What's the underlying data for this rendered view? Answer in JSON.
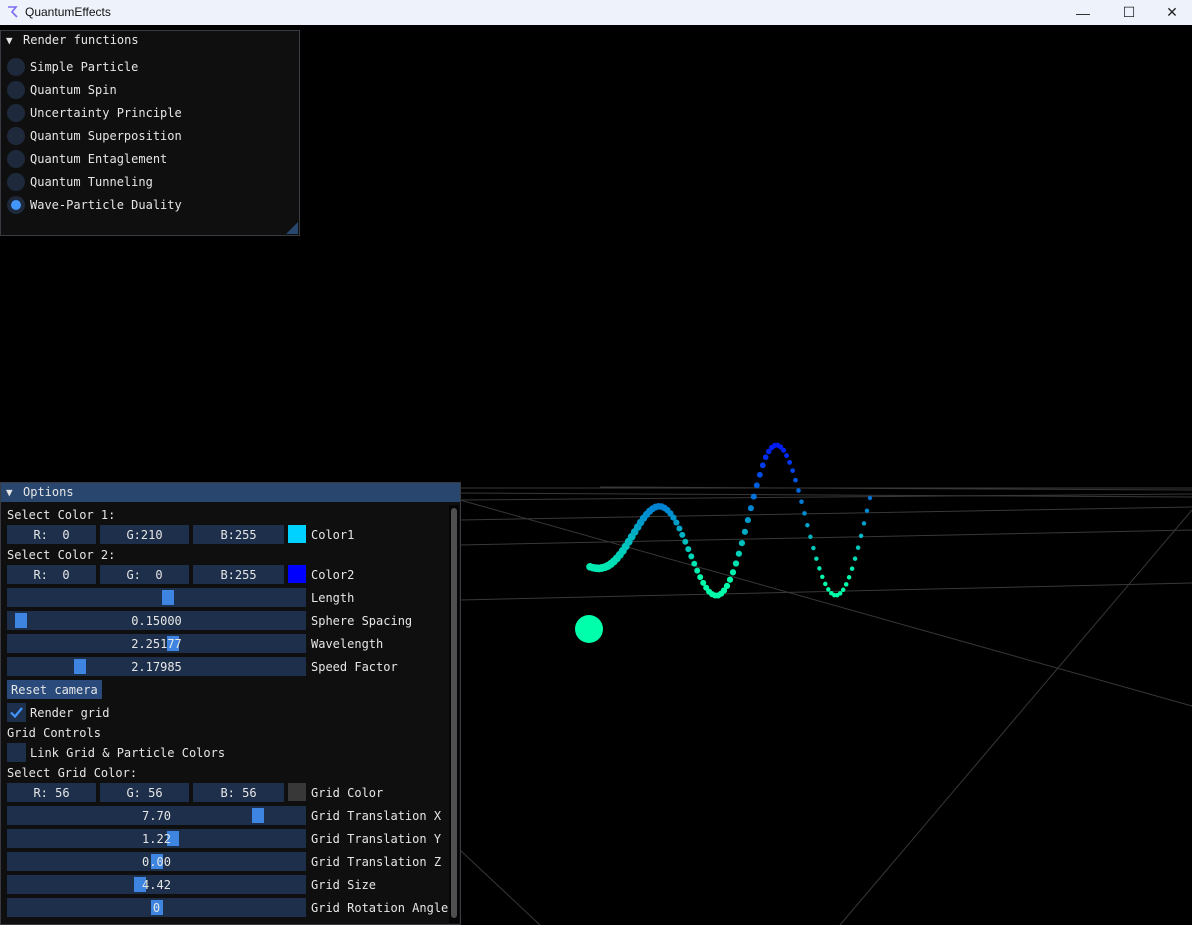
{
  "window": {
    "title": "QuantumEffects",
    "minimize": "—",
    "maximize": "☐",
    "close": "✕"
  },
  "render_panel": {
    "title": "Render functions",
    "options": [
      {
        "label": "Simple Particle",
        "selected": false
      },
      {
        "label": "Quantum Spin",
        "selected": false
      },
      {
        "label": "Uncertainty Principle",
        "selected": false
      },
      {
        "label": "Quantum Superposition",
        "selected": false
      },
      {
        "label": "Quantum Entaglement",
        "selected": false
      },
      {
        "label": "Quantum Tunneling",
        "selected": false
      },
      {
        "label": "Wave-Particle Duality",
        "selected": true
      }
    ]
  },
  "options_panel": {
    "title": "Options",
    "color1": {
      "heading": "Select Color 1:",
      "r": "R:  0",
      "g": "G:210",
      "b": "B:255",
      "label": "Color1",
      "swatch": "#00d2ff"
    },
    "color2": {
      "heading": "Select Color 2:",
      "r": "R:  0",
      "g": "G:  0",
      "b": "B:255",
      "label": "Color2",
      "swatch": "#0000ff"
    },
    "length": {
      "label": "Length",
      "value": "",
      "fraction": 0.54
    },
    "sphere_spacing": {
      "label": "Sphere Spacing",
      "value": "0.15000",
      "fraction": 0.02
    },
    "wavelength": {
      "label": "Wavelength",
      "value": "2.25177",
      "fraction": 0.56
    },
    "speed_factor": {
      "label": "Speed Factor",
      "value": "2.17985",
      "fraction": 0.23
    },
    "reset_camera": "Reset camera",
    "render_grid": {
      "label": "Render grid",
      "checked": true
    },
    "grid_controls": "Grid Controls",
    "link_colors": {
      "label": "Link Grid & Particle Colors",
      "checked": false
    },
    "grid_color": {
      "heading": "Select Grid Color:",
      "r": "R: 56",
      "g": "G: 56",
      "b": "B: 56",
      "label": "Grid Color",
      "swatch": "#383838"
    },
    "grid_tx": {
      "label": "Grid Translation X",
      "value": "7.70",
      "fraction": 0.86
    },
    "grid_ty": {
      "label": "Grid Translation Y",
      "value": "1.22",
      "fraction": 0.56
    },
    "grid_tz": {
      "label": "Grid Translation Z",
      "value": "0.00",
      "fraction": 0.5
    },
    "grid_size": {
      "label": "Grid Size",
      "value": "4.42",
      "fraction": 0.44
    },
    "grid_rot": {
      "label": "Grid Rotation Angle",
      "value": "0",
      "fraction": 0.5
    }
  },
  "colors": {
    "accent": "#4296fa",
    "slider_grab": "#3d85e0",
    "frame_bg": "#1d2f4a",
    "header_active": "#29466e",
    "wave_start": "#00ffaa",
    "wave_end": "#0000ff",
    "grid_line": "#383838"
  }
}
